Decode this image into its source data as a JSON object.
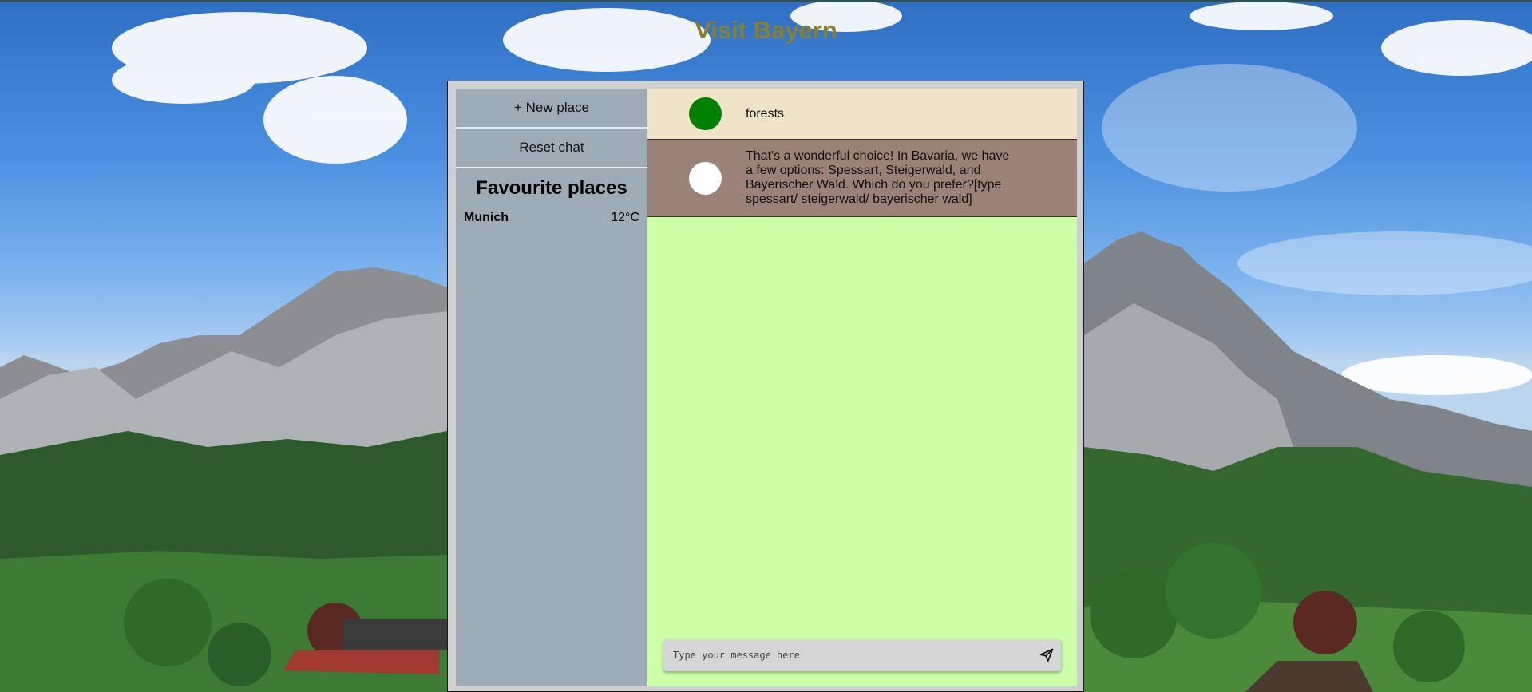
{
  "header": {
    "title": "Visit Bayern"
  },
  "sidebar": {
    "new_place_label": "+ New place",
    "reset_chat_label": "Reset chat",
    "favourites_title": "Favourite places",
    "favourites": [
      {
        "name": "Munich",
        "temperature": "12°C"
      }
    ]
  },
  "chat": {
    "messages": [
      {
        "role": "user",
        "avatar_color": "#008000",
        "text": "forests"
      },
      {
        "role": "bot",
        "avatar_color": "#ffffff",
        "text": "That's a wonderful choice! In Bavaria, we have a few options: Spessart, Steigerwald, and Bayerischer Wald. Which do you prefer?[type spessart/ steigerwald/ bayerischer wald]"
      }
    ],
    "input": {
      "placeholder": "Type your message here",
      "value": ""
    },
    "send_icon": "paper-plane-icon"
  },
  "colors": {
    "title": "#8a7f2c",
    "sidebar_bg": "#9eabb4",
    "chat_bg": "#ccffa8",
    "user_msg_bg": "#efe3c8",
    "bot_msg_bg": "#9b8279"
  }
}
